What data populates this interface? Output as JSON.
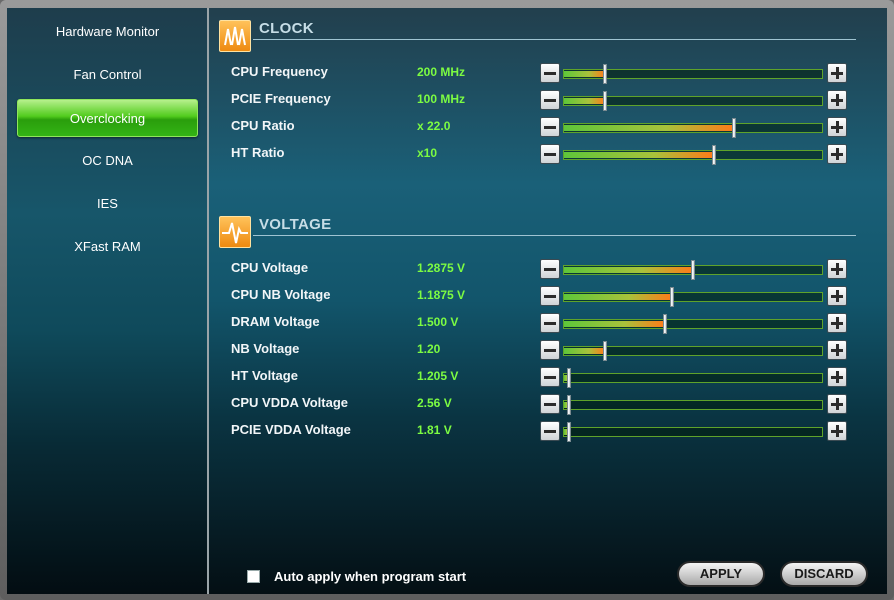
{
  "sidebar": {
    "items": [
      {
        "label": "Hardware Monitor"
      },
      {
        "label": "Fan Control"
      },
      {
        "label": "Overclocking",
        "active": true
      },
      {
        "label": "OC DNA"
      },
      {
        "label": "IES"
      },
      {
        "label": "XFast RAM"
      }
    ]
  },
  "clock": {
    "title": "CLOCK",
    "icon": "clock-wave-icon",
    "rows": [
      {
        "label": "CPU Frequency",
        "value": "200 MHz",
        "level": 0.16
      },
      {
        "label": "PCIE Frequency",
        "value": "100 MHz",
        "level": 0.16
      },
      {
        "label": "CPU Ratio",
        "value": "x 22.0",
        "level": 0.66
      },
      {
        "label": "HT Ratio",
        "value": "x10",
        "level": 0.58
      }
    ]
  },
  "voltage": {
    "title": "VOLTAGE",
    "icon": "voltage-pulse-icon",
    "rows": [
      {
        "label": "CPU Voltage",
        "value": "1.2875 V",
        "level": 0.5
      },
      {
        "label": "CPU NB Voltage",
        "value": "1.1875 V",
        "level": 0.42
      },
      {
        "label": "DRAM Voltage",
        "value": "1.500 V",
        "level": 0.39
      },
      {
        "label": "NB Voltage",
        "value": "1.20",
        "level": 0.16
      },
      {
        "label": "HT Voltage",
        "value": "1.205 V",
        "level": 0.02
      },
      {
        "label": "CPU VDDA Voltage",
        "value": "2.56 V",
        "level": 0.02
      },
      {
        "label": "PCIE VDDA Voltage",
        "value": "1.81 V",
        "level": 0.02
      }
    ]
  },
  "footer": {
    "auto_apply_label": "Auto apply when program start",
    "auto_apply_checked": false,
    "apply_label": "APPLY",
    "discard_label": "DISCARD"
  },
  "colors": {
    "accent_green": "#52cc1e",
    "value_green": "#7cfc42",
    "section_icon_orange": "#ee8a10"
  }
}
